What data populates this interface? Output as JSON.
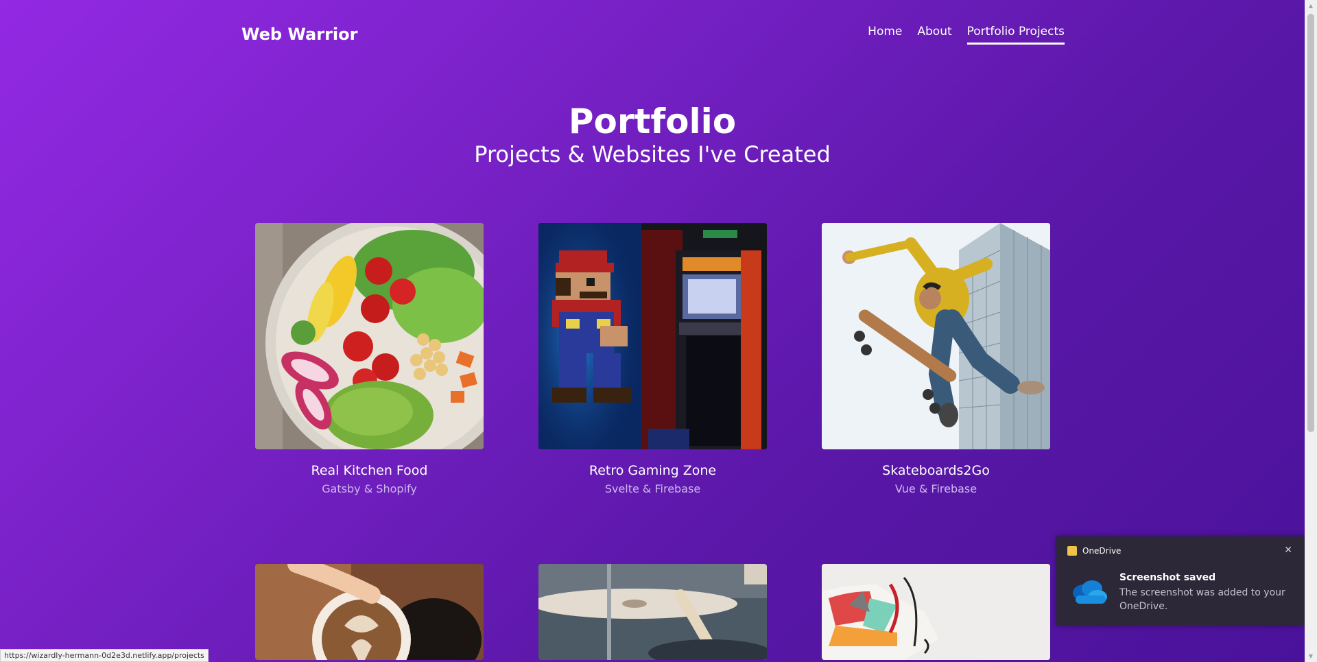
{
  "header": {
    "logo": "Web Warrior",
    "nav": [
      {
        "label": "Home"
      },
      {
        "label": "About"
      },
      {
        "label": "Portfolio Projects"
      }
    ]
  },
  "hero": {
    "title": "Portfolio",
    "subtitle": "Projects & Websites I've Created"
  },
  "projects": [
    {
      "title": "Real Kitchen Food",
      "stack": "Gatsby & Shopify"
    },
    {
      "title": "Retro Gaming Zone",
      "stack": "Svelte & Firebase"
    },
    {
      "title": "Skateboards2Go",
      "stack": "Vue & Firebase"
    }
  ],
  "status_bar": {
    "url": "https://wizardly-hermann-0d2e3d.netlify.app/projects"
  },
  "toast": {
    "app": "OneDrive",
    "title": "Screenshot saved",
    "body": "The screenshot was added to your OneDrive."
  },
  "colors": {
    "gradient_start": "#9329e3",
    "gradient_end": "#4a129a",
    "card_subtitle": "#cdb8ee"
  }
}
